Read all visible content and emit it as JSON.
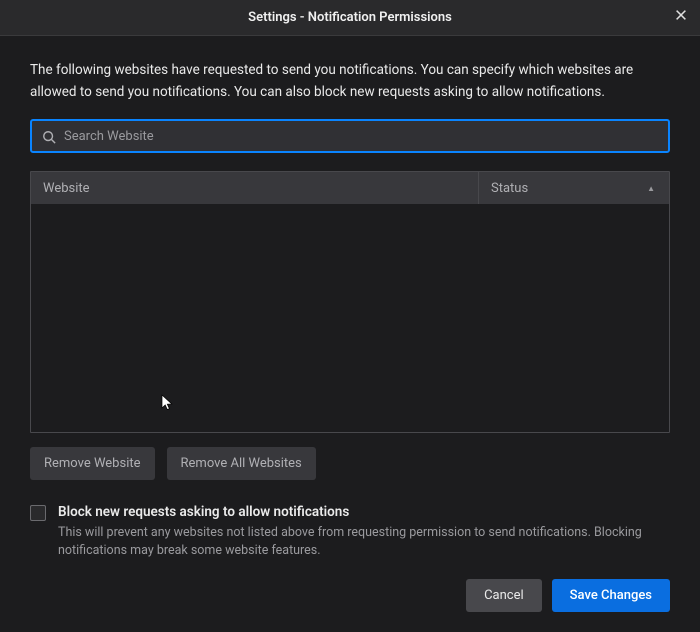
{
  "titlebar": {
    "title": "Settings - Notification Permissions"
  },
  "description": "The following websites have requested to send you notifications. You can specify which websites are allowed to send you notifications. You can also block new requests asking to allow notifications.",
  "search": {
    "placeholder": "Search Website",
    "value": ""
  },
  "table": {
    "columns": {
      "website": "Website",
      "status": "Status"
    },
    "rows": []
  },
  "buttons": {
    "remove_website": "Remove Website",
    "remove_all": "Remove All Websites",
    "cancel": "Cancel",
    "save": "Save Changes"
  },
  "block_checkbox": {
    "checked": false,
    "label": "Block new requests asking to allow notifications",
    "description": "This will prevent any websites not listed above from requesting permission to send notifications. Blocking notifications may break some website features."
  }
}
